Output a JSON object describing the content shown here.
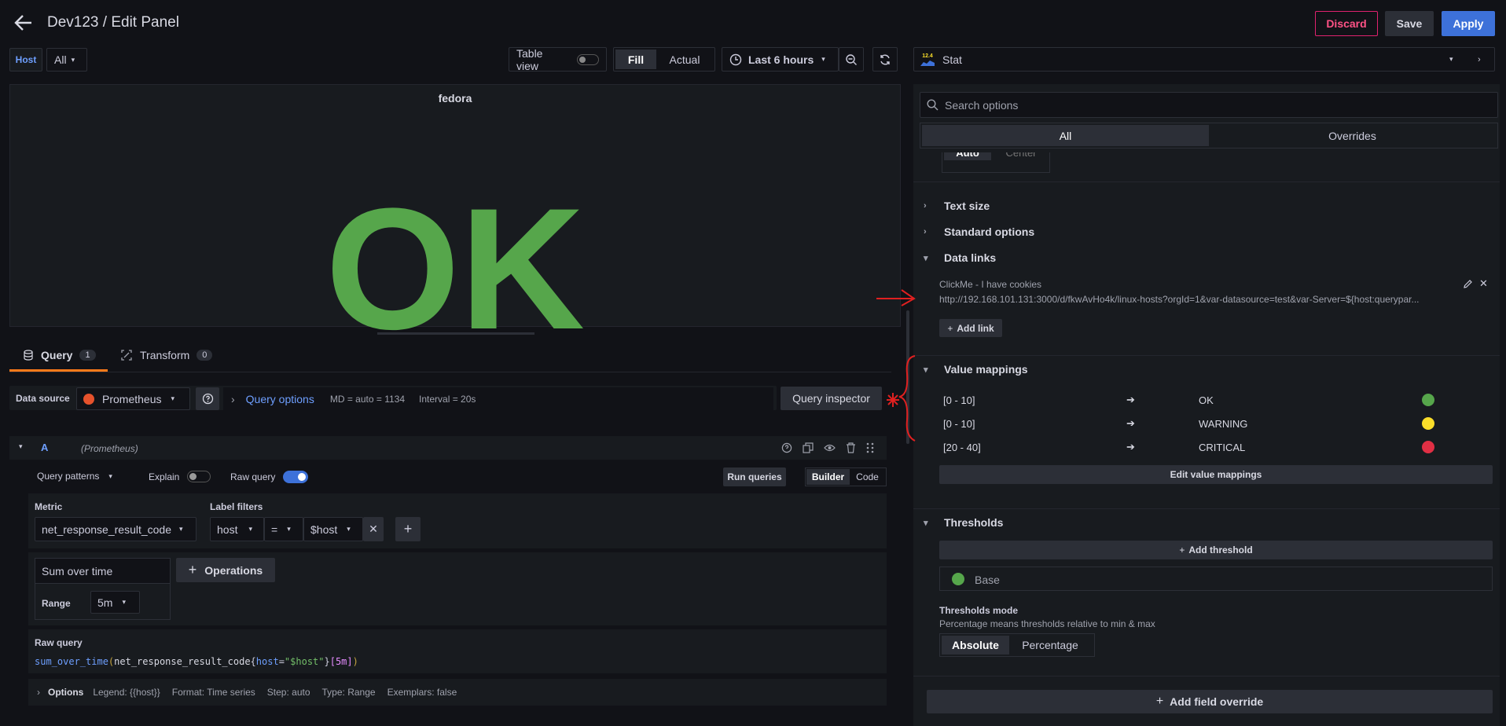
{
  "header": {
    "title": "Dev123 / Edit Panel",
    "discard_label": "Discard",
    "save_label": "Save",
    "apply_label": "Apply"
  },
  "toolbar": {
    "host_var_label": "Host",
    "host_var_value": "All",
    "table_view_label": "Table view",
    "fill_label": "Fill",
    "actual_label": "Actual",
    "time_range": "Last 6 hours"
  },
  "panel": {
    "title": "fedora",
    "value": "OK",
    "value_color": "#56a64b"
  },
  "query_tabs": {
    "query_label": "Query",
    "query_count": "1",
    "transform_label": "Transform",
    "transform_count": "0"
  },
  "datasource": {
    "label": "Data source",
    "name": "Prometheus",
    "query_options_label": "Query options",
    "md_info": "MD = auto = 1134",
    "interval_info": "Interval = 20s",
    "inspector_label": "Query inspector"
  },
  "query": {
    "ref_id": "A",
    "source": "(Prometheus)",
    "patterns_label": "Query patterns",
    "explain_label": "Explain",
    "raw_query_label": "Raw query",
    "run_label": "Run queries",
    "builder_label": "Builder",
    "code_label": "Code",
    "metric_label": "Metric",
    "metric_value": "net_response_result_code",
    "label_filters_label": "Label filters",
    "filter_key": "host",
    "filter_op": "=",
    "filter_value": "$host",
    "operation_name": "Sum over time",
    "range_label": "Range",
    "range_value": "5m",
    "operations_label": "Operations",
    "raw_section_label": "Raw query",
    "raw_fn": "sum_over_time",
    "raw_metric": "net_response_result_code",
    "raw_label_key": "host",
    "raw_label_val": "\"$host\"",
    "raw_range": "[5m]",
    "options_label": "Options",
    "legend": "Legend: {{host}}",
    "format": "Format: Time series",
    "step": "Step: auto",
    "type": "Type: Range",
    "exemplars": "Exemplars: false"
  },
  "options_pane": {
    "viz_name": "Stat",
    "search_placeholder": "Search options",
    "tab_all": "All",
    "tab_overrides": "Overrides",
    "partial_auto": "Auto",
    "partial_center": "Center",
    "text_size": "Text size",
    "standard_options": "Standard options",
    "data_links": "Data links",
    "link_title": "ClickMe - I have cookies",
    "link_url": "http://192.168.101.131:3000/d/fkwAvHo4k/linux-hosts?orgId=1&var-datasource=test&var-Server=${host:querypar...",
    "add_link": "Add link",
    "value_mappings": "Value mappings",
    "mappings": [
      {
        "range": "[0 - 10]",
        "text": "OK",
        "color": "#56a64b"
      },
      {
        "range": "[0 - 10]",
        "text": "WARNING",
        "color": "#fade2a"
      },
      {
        "range": "[20 - 40]",
        "text": "CRITICAL",
        "color": "#e02f44"
      }
    ],
    "edit_mappings": "Edit value mappings",
    "thresholds": "Thresholds",
    "add_threshold": "Add threshold",
    "base_label": "Base",
    "base_color": "#56a64b",
    "thresholds_mode": "Thresholds mode",
    "thresholds_mode_desc": "Percentage means thresholds relative to min & max",
    "absolute": "Absolute",
    "percentage": "Percentage",
    "add_override": "Add field override"
  }
}
